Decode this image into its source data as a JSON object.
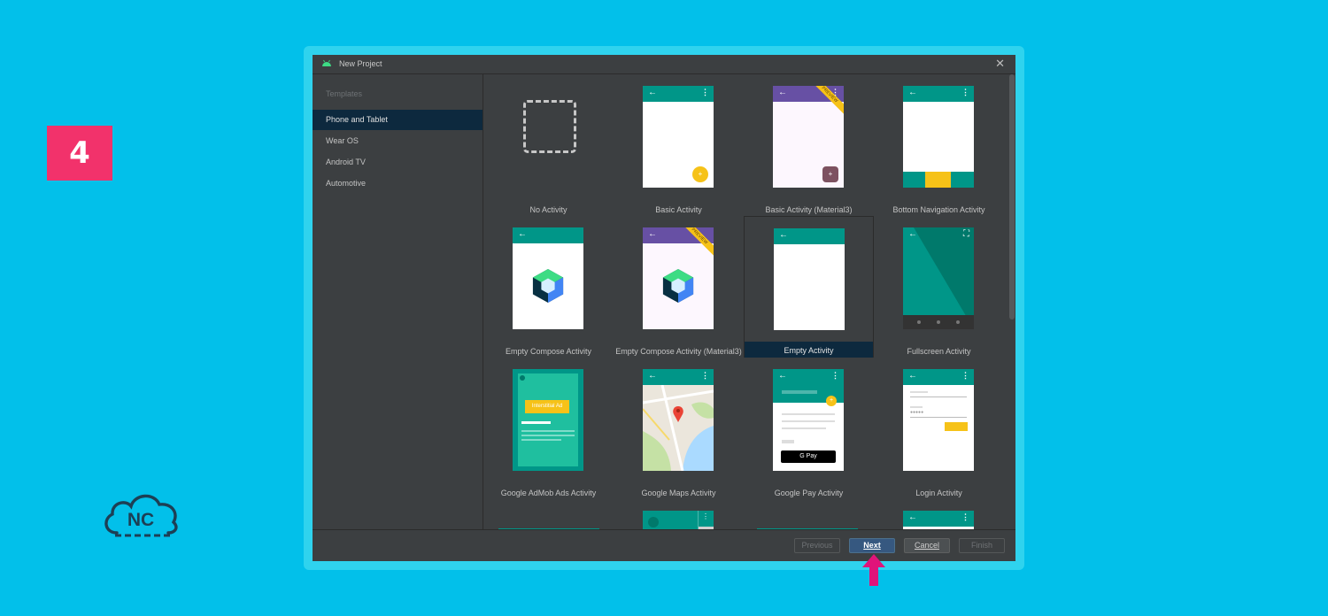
{
  "step_number": "4",
  "logo": {
    "text": "NC"
  },
  "dialog": {
    "title": "New Project",
    "sidebar": {
      "heading": "Templates",
      "items": [
        {
          "label": "Phone and Tablet",
          "selected": true
        },
        {
          "label": "Wear OS"
        },
        {
          "label": "Android TV"
        },
        {
          "label": "Automotive"
        }
      ]
    },
    "templates": [
      {
        "label": "No Activity"
      },
      {
        "label": "Basic Activity"
      },
      {
        "label": "Basic Activity (Material3)",
        "ribbon": "PREVIEW"
      },
      {
        "label": "Bottom Navigation Activity"
      },
      {
        "label": "Empty Compose Activity"
      },
      {
        "label": "Empty Compose Activity (Material3)",
        "ribbon": "PREVIEW"
      },
      {
        "label": "Empty Activity",
        "selected": true
      },
      {
        "label": "Fullscreen Activity"
      },
      {
        "label": "Google AdMob Ads Activity",
        "ad_text": "Interstitial Ad"
      },
      {
        "label": "Google Maps Activity"
      },
      {
        "label": "Google Pay Activity",
        "pay_text": "G Pay"
      },
      {
        "label": "Login Activity"
      }
    ],
    "footer": {
      "previous": "Previous",
      "next": "Next",
      "cancel": "Cancel",
      "finish": "Finish"
    }
  },
  "colors": {
    "background": "#02c0ea",
    "badge": "#f2326b",
    "teal": "#009688",
    "purple": "#6750a4",
    "accent_yellow": "#f6c218",
    "selection": "#0d293e",
    "primary_button": "#365880",
    "pointer": "#e0147a"
  }
}
